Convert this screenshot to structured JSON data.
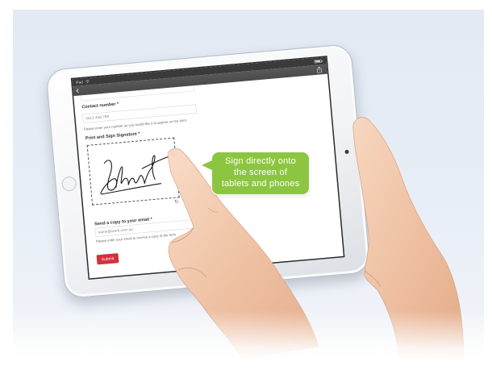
{
  "colors": {
    "background": "#e6edf5",
    "callout": "#8cc640",
    "submit": "#d42f3d",
    "status_bar": "#3a3a3a",
    "nav_bar": "#4e4e4e"
  },
  "icons": {
    "back": "chevron-left-icon",
    "share": "share-icon",
    "wifi": "wifi-icon",
    "battery": "battery-icon",
    "clear_signature": "refresh-icon",
    "home_button": "home-button-icon"
  },
  "status_bar": {
    "carrier": "iPad"
  },
  "form": {
    "contact": {
      "label": "Contact number *",
      "value": "0412 456 789",
      "help": "Please enter your number as you would like it to appear on the form."
    },
    "signature": {
      "label": "Print and Sign Signature *"
    },
    "email": {
      "label": "Send a copy to your email *",
      "value": "name@work.com.au",
      "help": "Please enter your email to receive a copy of the form"
    },
    "submit_label": "Submit"
  },
  "callout": {
    "line1": "Sign directly onto",
    "line2": "the screen of",
    "line3": "tablets and phones"
  }
}
